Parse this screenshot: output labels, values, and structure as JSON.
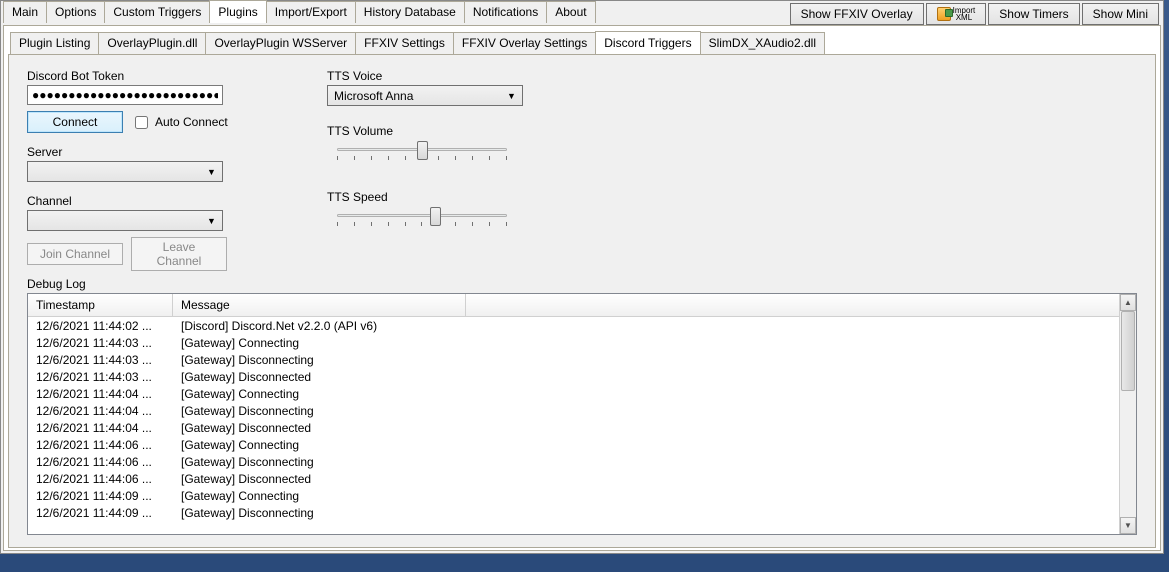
{
  "main_tabs": [
    "Main",
    "Options",
    "Custom Triggers",
    "Plugins",
    "Import/Export",
    "History Database",
    "Notifications",
    "About"
  ],
  "main_tab_active": 3,
  "right_buttons": {
    "overlay": "Show FFXIV Overlay",
    "import_xml_top": "Import",
    "import_xml_bottom": "XML",
    "show_timers": "Show Timers",
    "show_mini": "Show Mini"
  },
  "sub_tabs": [
    "Plugin Listing",
    "OverlayPlugin.dll",
    "OverlayPlugin WSServer",
    "FFXIV Settings",
    "FFXIV Overlay Settings",
    "Discord Triggers",
    "SlimDX_XAudio2.dll"
  ],
  "sub_tab_active": 5,
  "left": {
    "token_label": "Discord Bot Token",
    "token_value": "●●●●●●●●●●●●●●●●●●●●●●●●●●●●●●",
    "connect": "Connect",
    "auto_connect": "Auto Connect",
    "server_label": "Server",
    "server_value": "",
    "channel_label": "Channel",
    "channel_value": "",
    "join": "Join Channel",
    "leave": "Leave Channel"
  },
  "right": {
    "voice_label": "TTS Voice",
    "voice_value": "Microsoft Anna",
    "volume_label": "TTS Volume",
    "volume_pos": 0.5,
    "speed_label": "TTS Speed",
    "speed_pos": 0.58
  },
  "debug_label": "Debug Log",
  "debug_headers": {
    "ts": "Timestamp",
    "msg": "Message"
  },
  "debug_rows": [
    {
      "ts": "12/6/2021 11:44:02 ...",
      "msg": "[Discord] Discord.Net v2.2.0 (API v6)"
    },
    {
      "ts": "12/6/2021 11:44:03 ...",
      "msg": "[Gateway] Connecting"
    },
    {
      "ts": "12/6/2021 11:44:03 ...",
      "msg": "[Gateway] Disconnecting"
    },
    {
      "ts": "12/6/2021 11:44:03 ...",
      "msg": "[Gateway] Disconnected"
    },
    {
      "ts": "12/6/2021 11:44:04 ...",
      "msg": "[Gateway] Connecting"
    },
    {
      "ts": "12/6/2021 11:44:04 ...",
      "msg": "[Gateway] Disconnecting"
    },
    {
      "ts": "12/6/2021 11:44:04 ...",
      "msg": "[Gateway] Disconnected"
    },
    {
      "ts": "12/6/2021 11:44:06 ...",
      "msg": "[Gateway] Connecting"
    },
    {
      "ts": "12/6/2021 11:44:06 ...",
      "msg": "[Gateway] Disconnecting"
    },
    {
      "ts": "12/6/2021 11:44:06 ...",
      "msg": "[Gateway] Disconnected"
    },
    {
      "ts": "12/6/2021 11:44:09 ...",
      "msg": "[Gateway] Connecting"
    },
    {
      "ts": "12/6/2021 11:44:09 ...",
      "msg": "[Gateway] Disconnecting"
    }
  ]
}
